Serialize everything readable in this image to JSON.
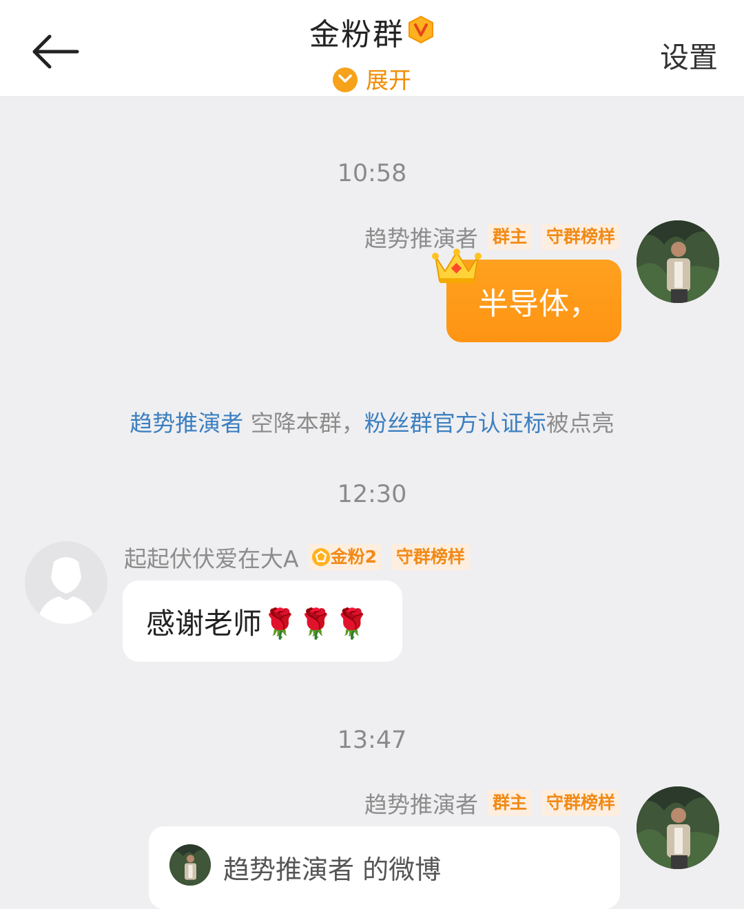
{
  "header": {
    "title": "金粉群",
    "expand_label": "展开",
    "settings_label": "设置"
  },
  "messages": {
    "time1": "10:58",
    "msg1": {
      "sender": "趋势推演者",
      "tag1": "群主",
      "tag2": "守群榜样",
      "text": "半导体，"
    },
    "system": {
      "name": "趋势推演者",
      "text1": " 空降本群，",
      "link": "粉丝群官方认证标",
      "text2": "被点亮"
    },
    "time2": "12:30",
    "msg2": {
      "sender": "起起伏伏爱在大A",
      "tag1": "金粉2",
      "tag2": "守群榜样",
      "text": "感谢老师🌹🌹🌹"
    },
    "time3": "13:47",
    "msg3": {
      "sender": "趋势推演者",
      "tag1": "群主",
      "tag2": "守群榜样",
      "card_text": "趋势推演者 的微博"
    }
  },
  "colors": {
    "accent": "#ff9a17",
    "link": "#3c7fc0",
    "tag_bg": "#fdeee0",
    "tag_fg": "#f18a16"
  }
}
